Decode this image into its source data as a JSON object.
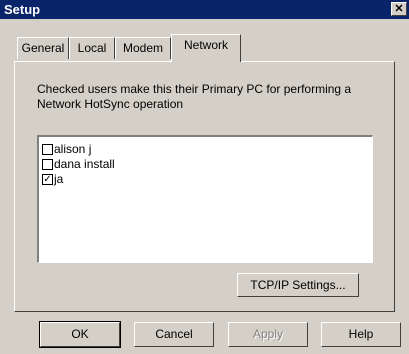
{
  "window": {
    "title": "Setup",
    "close_glyph": "✕"
  },
  "tabs": [
    {
      "label": "General",
      "active": false
    },
    {
      "label": "Local",
      "active": false
    },
    {
      "label": "Modem",
      "active": false
    },
    {
      "label": "Network",
      "active": true
    }
  ],
  "network": {
    "description": "Checked users make this their Primary PC for performing a Network HotSync operation",
    "users": [
      {
        "label": "alison j",
        "checked": false
      },
      {
        "label": "dana install",
        "checked": false
      },
      {
        "label": "ja",
        "checked": true
      }
    ],
    "tcpip_button": "TCP/IP Settings..."
  },
  "buttons": {
    "ok": "OK",
    "cancel": "Cancel",
    "apply": "Apply",
    "help": "Help"
  }
}
